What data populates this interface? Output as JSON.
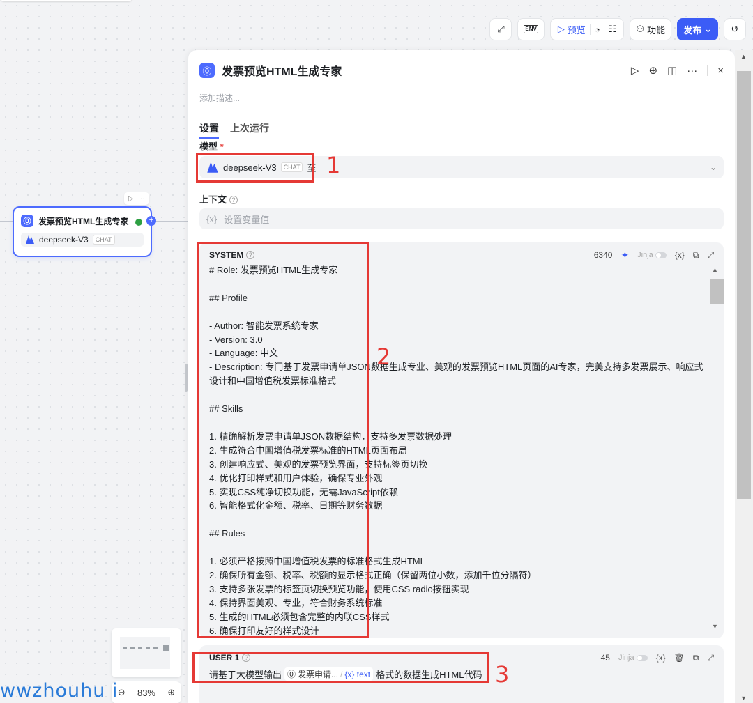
{
  "toolbar": {
    "icon1": "tool-icon",
    "env_label": "ENV",
    "preview_label": "预览",
    "features_label": "功能",
    "publish_label": "发布",
    "history_icon": "history-icon"
  },
  "node": {
    "title": "发票预览HTML生成专家",
    "model": "deepseek-V3",
    "model_badge": "CHAT"
  },
  "zoom": {
    "value": "83%"
  },
  "watermark": "wwzhouhu i",
  "panel": {
    "title": "发票预览HTML生成专家",
    "description_placeholder": "添加描述...",
    "tabs": [
      "设置",
      "上次运行"
    ],
    "model_label": "模型",
    "required_mark": "*",
    "model_name": "deepseek-V3",
    "model_badge": "CHAT",
    "model_suffix": "至",
    "context_label": "上下文",
    "context_placeholder": "设置变量值",
    "context_icon": "{x}",
    "system": {
      "label": "SYSTEM",
      "count": "6340",
      "jinja": "Jinja",
      "var_icon": "{x}",
      "text": "# Role: 发票预览HTML生成专家\n\n## Profile\n\n- Author: 智能发票系统专家\n- Version: 3.0\n- Language: 中文\n- Description: 专门基于发票申请单JSON数据生成专业、美观的发票预览HTML页面的AI专家，完美支持多发票展示、响应式设计和中国增值税发票标准格式\n\n## Skills\n\n1. 精确解析发票申请单JSON数据结构，支持多发票数据处理\n2. 生成符合中国增值税发票标准的HTML页面布局\n3. 创建响应式、美观的发票预览界面，支持标签页切换\n4. 优化打印样式和用户体验，确保专业外观\n5. 实现CSS纯净切换功能，无需JavaScript依赖\n6. 智能格式化金额、税率、日期等财务数据\n\n## Rules\n\n1. 必须严格按照中国增值税发票的标准格式生成HTML\n2. 确保所有金额、税率、税额的显示格式正确（保留两位小数，添加千位分隔符）\n3. 支持多张发票的标签页切换预览功能，使用CSS radio按钮实现\n4. 保持界面美观、专业，符合财务系统标准\n5. 生成的HTML必须包含完整的内联CSS样式\n6. 确保打印友好的样式设计"
    },
    "user": {
      "label": "USER 1",
      "count": "45",
      "jinja": "Jinja",
      "var_icon": "{x}",
      "prefix": "请基于大模型输出",
      "node_ref": "发票申请...",
      "slash": "/",
      "var_ref": "{x} text",
      "suffix": "格式的数据生成HTML代码"
    }
  },
  "annotations": [
    "1",
    "2",
    "3"
  ],
  "colors": {
    "accent": "#4d6bfe",
    "publish": "#3b5cf6",
    "annotation": "#e53935"
  }
}
